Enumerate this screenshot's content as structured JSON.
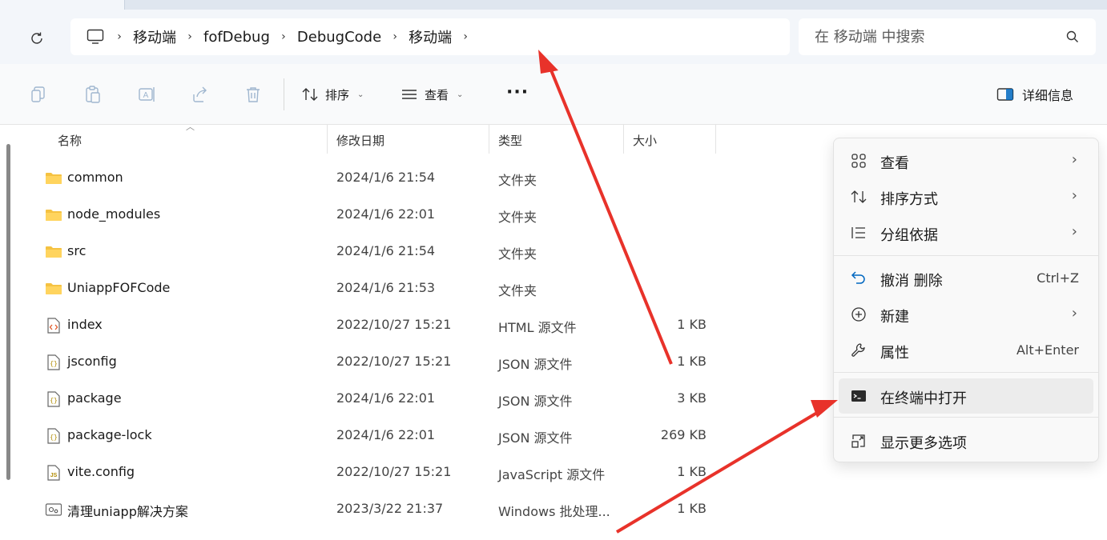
{
  "breadcrumb": {
    "items": [
      "移动端",
      "fofDebug",
      "DebugCode",
      "移动端"
    ],
    "separator": "›"
  },
  "search": {
    "placeholder": "在 移动端 中搜索"
  },
  "toolbar": {
    "sort_label": "排序",
    "view_label": "查看",
    "more_label": "···",
    "details_label": "详细信息"
  },
  "columns": {
    "name": "名称",
    "modified": "修改日期",
    "type": "类型",
    "size": "大小"
  },
  "files": [
    {
      "name": "common",
      "modified": "2024/1/6 21:54",
      "type": "文件夹",
      "size": "",
      "icon": "folder-icon"
    },
    {
      "name": "node_modules",
      "modified": "2024/1/6 22:01",
      "type": "文件夹",
      "size": "",
      "icon": "folder-icon"
    },
    {
      "name": "src",
      "modified": "2024/1/6 21:54",
      "type": "文件夹",
      "size": "",
      "icon": "folder-icon"
    },
    {
      "name": "UniappFOFCode",
      "modified": "2024/1/6 21:53",
      "type": "文件夹",
      "size": "",
      "icon": "folder-icon"
    },
    {
      "name": "index",
      "modified": "2022/10/27 15:21",
      "type": "HTML 源文件",
      "size": "1 KB",
      "icon": "html-file-icon"
    },
    {
      "name": "jsconfig",
      "modified": "2022/10/27 15:21",
      "type": "JSON 源文件",
      "size": "1 KB",
      "icon": "json-file-icon"
    },
    {
      "name": "package",
      "modified": "2024/1/6 22:01",
      "type": "JSON 源文件",
      "size": "3 KB",
      "icon": "json-file-icon"
    },
    {
      "name": "package-lock",
      "modified": "2024/1/6 22:01",
      "type": "JSON 源文件",
      "size": "269 KB",
      "icon": "json-file-icon"
    },
    {
      "name": "vite.config",
      "modified": "2022/10/27 15:21",
      "type": "JavaScript 源文件",
      "size": "1 KB",
      "icon": "js-file-icon"
    },
    {
      "name": "清理uniapp解决方案",
      "modified": "2023/3/22 21:37",
      "type": "Windows 批处理...",
      "size": "1 KB",
      "icon": "batch-file-icon"
    }
  ],
  "context_menu": {
    "items": [
      {
        "label": "查看",
        "shortcut": "",
        "submenu": true,
        "icon": "grid-icon"
      },
      {
        "label": "排序方式",
        "shortcut": "",
        "submenu": true,
        "icon": "sort-icon"
      },
      {
        "label": "分组依据",
        "shortcut": "",
        "submenu": true,
        "icon": "group-icon"
      },
      {
        "label": "撤消 删除",
        "shortcut": "Ctrl+Z",
        "submenu": false,
        "icon": "undo-icon"
      },
      {
        "label": "新建",
        "shortcut": "",
        "submenu": true,
        "icon": "new-icon"
      },
      {
        "label": "属性",
        "shortcut": "Alt+Enter",
        "submenu": false,
        "icon": "wrench-icon"
      },
      {
        "label": "在终端中打开",
        "shortcut": "",
        "submenu": false,
        "icon": "terminal-icon"
      },
      {
        "label": "显示更多选项",
        "shortcut": "",
        "submenu": false,
        "icon": "more-options-icon"
      }
    ],
    "chevron": "›"
  },
  "colors": {
    "folder": "#f5c242",
    "arrow": "#e8322a",
    "accent": "#0067c0"
  }
}
